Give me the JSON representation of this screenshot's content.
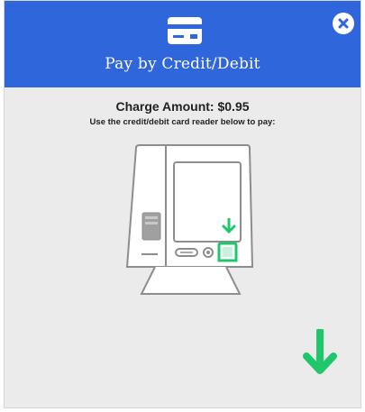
{
  "header": {
    "title": "Pay by Credit/Debit",
    "icon": "credit-card-icon",
    "background_color": "#2f66dc"
  },
  "close_button": {
    "icon": "close-icon"
  },
  "content": {
    "charge_label": "Charge Amount: $0.95",
    "instruction": "Use the credit/debit card reader below to pay:"
  },
  "illustration": {
    "icon": "kiosk-card-reader-illustration",
    "accent_color": "#1ec86a"
  },
  "indicator": {
    "icon": "down-arrow-icon",
    "color": "#1ec86a"
  }
}
